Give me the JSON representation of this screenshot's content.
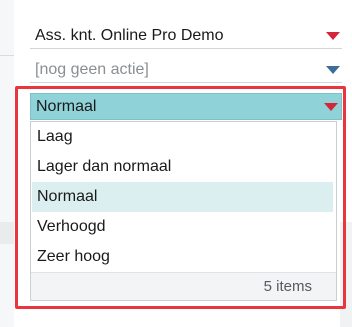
{
  "fields": [
    {
      "value": "Ass. knt. Online Pro Demo",
      "arrow_color": "#d6243a"
    },
    {
      "value": "[nog geen actie]",
      "arrow_color": "#3d6e97"
    }
  ],
  "priority_combo": {
    "value": "Normaal",
    "options": [
      "Laag",
      "Lager dan normaal",
      "Normaal",
      "Verhoogd",
      "Zeer hoog"
    ],
    "selected_index": 2,
    "footer": "5 items"
  },
  "colors": {
    "highlight_border": "#e8353e",
    "combo_background": "#8fd3d9",
    "selected_item_background": "#dceff0"
  }
}
